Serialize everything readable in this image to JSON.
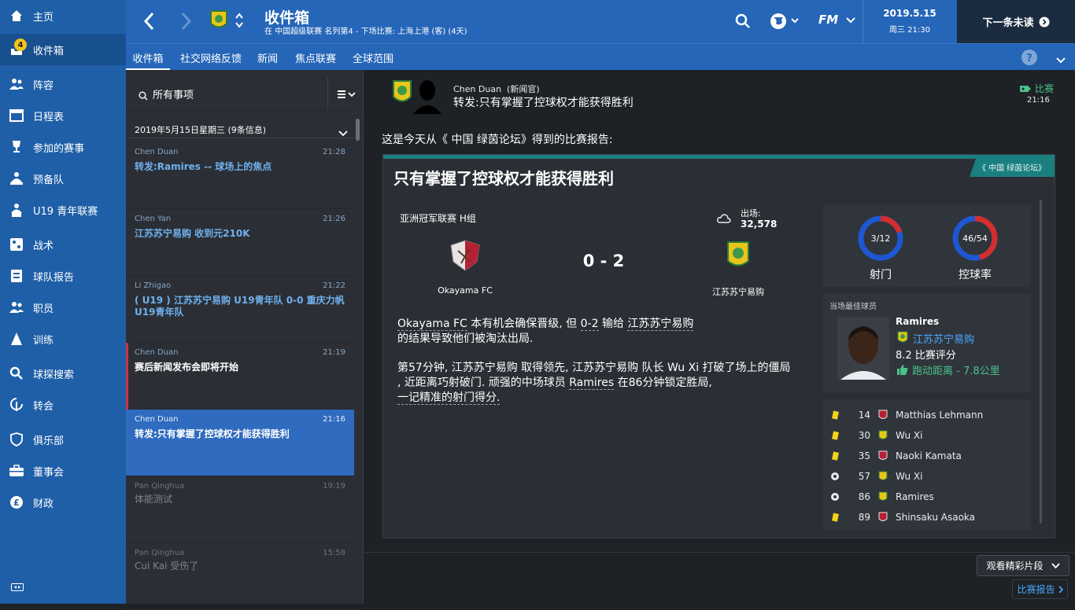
{
  "nav": {
    "items": [
      {
        "label": "主页",
        "icon": "home-icon"
      },
      {
        "label": "收件箱",
        "icon": "inbox-icon",
        "badge": "4"
      },
      {
        "label": "阵容",
        "icon": "squad-icon"
      },
      {
        "label": "日程表",
        "icon": "calendar-icon"
      },
      {
        "label": "参加的赛事",
        "icon": "trophy-icon"
      },
      {
        "label": "预备队",
        "icon": "reserve-icon"
      },
      {
        "label": "U19 青年联赛",
        "icon": "u19-icon"
      },
      {
        "label": "战术",
        "icon": "tactics-icon"
      },
      {
        "label": "球队报告",
        "icon": "report-icon"
      },
      {
        "label": "职员",
        "icon": "staff-icon"
      },
      {
        "label": "训练",
        "icon": "training-icon"
      },
      {
        "label": "球探搜索",
        "icon": "search-icon"
      },
      {
        "label": "转会",
        "icon": "transfer-icon"
      },
      {
        "label": "俱乐部",
        "icon": "club-icon"
      },
      {
        "label": "董事会",
        "icon": "board-icon"
      },
      {
        "label": "财政",
        "icon": "finance-icon"
      }
    ]
  },
  "header": {
    "title": "收件箱",
    "subtitle": "在 中国超级联赛 名列第4 - 下场比赛: 上海上港 (客) (4天)",
    "date": "2019.5.15",
    "weekday_time": "周三 21:30",
    "next_unread": "下一条未读",
    "fm_logo": "FM"
  },
  "tabs": [
    "收件箱",
    "社交网络反馈",
    "新闻",
    "焦点联赛",
    "全球范围"
  ],
  "list": {
    "filter_label": "所有事项",
    "date_group": "2019年5月15日星期三 (9条信息)",
    "messages": [
      {
        "sender": "Chen Duan",
        "time": "21:28",
        "subject": "转发:Ramires -- 球场上的焦点"
      },
      {
        "sender": "Chen Yan",
        "time": "21:26",
        "subject": "江苏苏宁易购 收到元210K"
      },
      {
        "sender": "Li Zhigao",
        "time": "21:22",
        "subject": "( U19 ) 江苏苏宁易购 U19青年队 0-0 重庆力帆 U19青年队"
      },
      {
        "sender": "Chen Duan",
        "time": "21:19",
        "subject": "赛后新闻发布会即将开始"
      },
      {
        "sender": "Chen Duan",
        "time": "21:16",
        "subject": "转发:只有掌握了控球权才能获得胜利"
      },
      {
        "sender": "Pan Qinghua",
        "time": "19:19",
        "subject": "体能测试"
      },
      {
        "sender": "Pan Qinghua",
        "time": "15:58",
        "subject": "Cui Kai 受伤了"
      }
    ]
  },
  "message": {
    "sender": "Chen Duan",
    "sender_role": "(新闻官)",
    "subject": "转发:只有掌握了控球权才能获得胜利",
    "tag": "比赛",
    "time": "21:16",
    "intro": "这是今天从《 中国 绿茵论坛》得到的比赛报告:",
    "source": "《 中国 绿茵论坛》",
    "headline": "只有掌握了控球权才能获得胜利",
    "competition": "亚洲冠军联赛 H组",
    "attendance_label": "出场:",
    "attendance": "32,578",
    "home_team": "Okayama FC",
    "away_team": "江苏苏宁易购",
    "score": "0 - 2",
    "para1": {
      "t1": "Okayama FC",
      "t2": " 本有机会确保晋级, 但 ",
      "t3": "0-2",
      "t4": " 输给 ",
      "t5": "江苏苏宁易购",
      "t6": "的结果导致他们被淘汰出局."
    },
    "para2": {
      "l1": "第57分钟, 江苏苏宁易购 取得领先, 江苏苏宁易购 队长 Wu Xi 打破了场上的僵局",
      "l2a": ", 近距离巧射破门. 顽强的中场球员 ",
      "l2b": "Ramires",
      "l2c": " 在86分钟锁定胜局,",
      "l3": "一记精准的射门得分."
    },
    "stats": {
      "shots_value": "3/12",
      "shots_label": "射门",
      "shots_home": 3,
      "shots_away": 12,
      "possession_value": "46/54",
      "possession_label": "控球率",
      "possession_home": 46,
      "possession_away": 54
    },
    "potm": {
      "label": "当场最佳球员",
      "name": "Ramires",
      "team": "江苏苏宁易购",
      "rating": "8.2 比赛评分",
      "distance": "跑动距离 - 7.8公里"
    },
    "events": [
      {
        "type": "yellow-card",
        "minute": "14",
        "team": "home",
        "player": "Matthias Lehmann"
      },
      {
        "type": "yellow-card",
        "minute": "30",
        "team": "away",
        "player": "Wu Xi"
      },
      {
        "type": "yellow-card",
        "minute": "35",
        "team": "home",
        "player": "Naoki Kamata"
      },
      {
        "type": "goal",
        "minute": "57",
        "team": "away",
        "player": "Wu Xi"
      },
      {
        "type": "goal",
        "minute": "86",
        "team": "away",
        "player": "Ramires"
      },
      {
        "type": "yellow-card",
        "minute": "89",
        "team": "home",
        "player": "Shinsaku Asaoka"
      }
    ],
    "highlights_button": "观看精彩片段",
    "match_report_link": "比赛报告"
  },
  "colors": {
    "sidebar": "#1f5fa8",
    "header": "#2566b8",
    "selected": "#2f6bbf",
    "accent_green": "#4bc18a",
    "teal": "#1a7f7f",
    "ring_red": "#d62d2d",
    "ring_blue": "#1d58d1"
  }
}
